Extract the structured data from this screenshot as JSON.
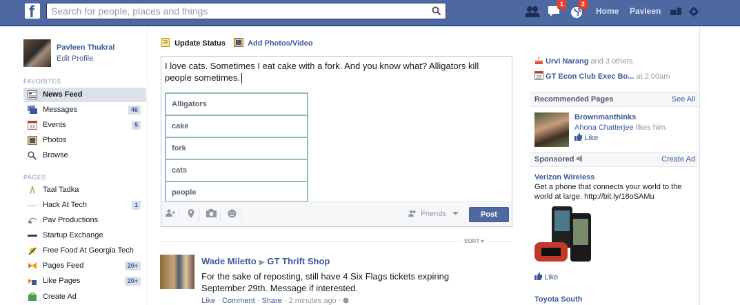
{
  "topbar": {
    "search_placeholder": "Search for people, places and things",
    "messages_badge": "1",
    "notifications_badge": "2",
    "home_label": "Home",
    "user_label": "Pavleen"
  },
  "left": {
    "profile_name": "Pavleen Thukral",
    "edit_profile": "Edit Profile",
    "favorites_heading": "FAVORITES",
    "favorites": [
      {
        "label": "News Feed",
        "count": ""
      },
      {
        "label": "Messages",
        "count": "46"
      },
      {
        "label": "Events",
        "count": "5"
      },
      {
        "label": "Photos",
        "count": ""
      },
      {
        "label": "Browse",
        "count": ""
      }
    ],
    "pages_heading": "PAGES",
    "pages": [
      {
        "label": "Taal Tadka",
        "count": ""
      },
      {
        "label": "Hack At Tech",
        "count": "1"
      },
      {
        "label": "Pav Productions",
        "count": ""
      },
      {
        "label": "Startup Exchange",
        "count": ""
      },
      {
        "label": "Free Food At Georgia Tech",
        "count": ""
      },
      {
        "label": "Pages Feed",
        "count": "20+"
      },
      {
        "label": "Like Pages",
        "count": "20+"
      },
      {
        "label": "Create Ad",
        "count": ""
      }
    ]
  },
  "composer": {
    "tab_status": "Update Status",
    "tab_photos": "Add Photos/Video",
    "text": "I love cats. Sometimes I eat cake with a fork. And you know what? Alligators kill people sometimes.",
    "suggestions": [
      "Alligators",
      "cake",
      "fork",
      "cats",
      "people"
    ],
    "audience": "Friends",
    "post_label": "Post"
  },
  "feed": {
    "sort_label": "SORT",
    "story": {
      "author": "Wade Miletto",
      "target": "GT Thrift Shop",
      "text": "For the sake of reposting, still have 4 Six Flags tickets expiring September 29th. Message if interested.",
      "like": "Like",
      "comment": "Comment",
      "share": "Share",
      "time": "2 minutes ago"
    }
  },
  "right": {
    "birthday_name": "Urvi Narang",
    "birthday_rest": "and 3 others",
    "event_name": "GT Econ Club Exec Bo...",
    "event_time": "at 2:00am",
    "event_day": "22",
    "recommended_heading": "Recommended Pages",
    "see_all": "See All",
    "rec_name": "Brownmanthinks",
    "rec_friend": "Ahona Chatterjee",
    "rec_friend_rest": "likes him.",
    "rec_like": "Like",
    "sponsored_heading": "Sponsored",
    "create_ad": "Create Ad",
    "ad_title": "Verizon Wireless",
    "ad_text": "Get a phone that connects your world to the world at large. http://bit.ly/18oSAMu",
    "ad_like": "Like",
    "ad2_title": "Toyota South"
  },
  "colors": {
    "topbar": "#4e69a2",
    "link": "#3b5998",
    "active_nav": "#dce1e8",
    "badge_red": "#f03d25"
  }
}
